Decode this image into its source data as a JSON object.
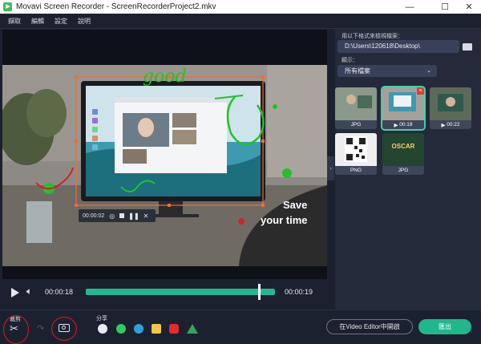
{
  "window": {
    "title": "Movavi Screen Recorder - ScreenRecorderProject2.mkv",
    "minimize": "—",
    "maximize": "☐",
    "close": "✕"
  },
  "menu": [
    "擷取",
    "編輯",
    "設定",
    "說明"
  ],
  "right_panel": {
    "folder_label": "用以下格式來檢視檔案：",
    "folder_path": "D:\\Users\\120618\\Desktop\\",
    "show_label": "顯示：",
    "filter_value": "所有檔案",
    "files": [
      {
        "label": "JPG",
        "selected": false
      },
      {
        "label": "00:19",
        "selected": true
      },
      {
        "label": "00:22",
        "selected": false
      },
      {
        "label": "PNG",
        "selected": false
      },
      {
        "label": "JPG",
        "selected": false
      }
    ],
    "oscar_text": "OSCAR"
  },
  "video": {
    "overlay_line1": "Save",
    "overlay_line2": "your time",
    "rec_time": "00:00:02",
    "handwriting": "good"
  },
  "player": {
    "current_time": "00:00:18",
    "total_time": "00:00:19",
    "progress": 0.915
  },
  "bottom": {
    "trim_label": "裁剪",
    "share_label": "分享",
    "open_editor_label": "在Video Editor中開啟",
    "export_label": "匯出"
  },
  "colors": {
    "accent": "#20b88b",
    "annotation_red": "#e01818",
    "annotation_green": "#22c22a",
    "selection_orange": "#f26b3a"
  }
}
